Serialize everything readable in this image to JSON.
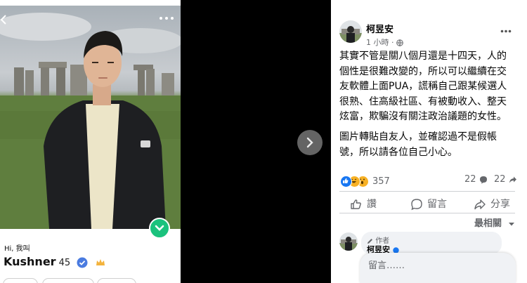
{
  "profile_card": {
    "greeting": "Hi, 我叫",
    "name": "Kushner",
    "age": "45",
    "icons": {
      "back": "back-arrow-icon",
      "more": "more-dots-icon",
      "like": "chevron-down-icon",
      "verified": "verified-badge-icon",
      "crown": "crown-icon"
    },
    "colors": {
      "like": "#1bc27d",
      "verified": "#4a7be0",
      "crown": "#f3b33d"
    }
  },
  "viewer": {
    "icons": {
      "next": "chevron-right-icon"
    }
  },
  "post": {
    "author": "柯昱安",
    "time": "1 小時",
    "separator": "·",
    "privacy_icon": "globe-icon",
    "paragraphs": [
      "其實不管是關八個月還是十四天，人的個性是很難改變的，所以可以繼續在交友軟體上面PUA，謊稱自己跟某候選人很熟、住高級社區、有被動收入、整天炫富，欺騙沒有關注政治議題的女性。",
      "圖片轉貼自友人，並確認過不是假帳號，所以請各位自己小心。"
    ],
    "reactions": {
      "types": [
        "like",
        "haha",
        "wow"
      ],
      "count": "357"
    },
    "comment_count": "22",
    "share_count": "22",
    "actions": {
      "like": "讚",
      "comment": "留言",
      "share": "分享"
    },
    "sort_label": "最相關",
    "comment": {
      "badge": "作者",
      "author": "柯昱安"
    },
    "comment_input": {
      "placeholder": "留言……"
    },
    "colors": {
      "like": "#1877f2",
      "haha": "#f7b125",
      "wow": "#f7b125"
    }
  }
}
